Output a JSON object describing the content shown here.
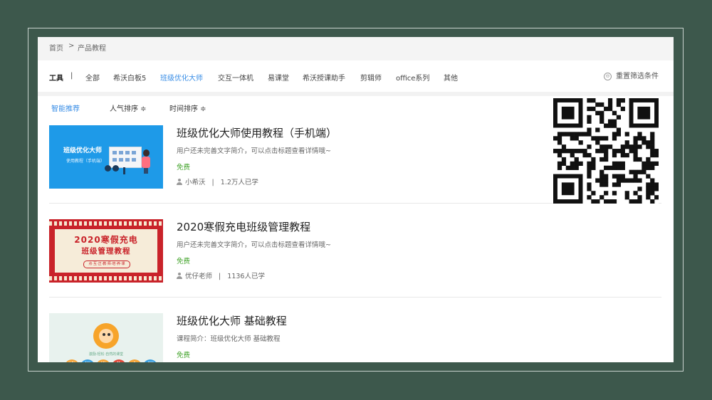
{
  "breadcrumb": {
    "home": "首页",
    "separator": ">",
    "current": "产品教程"
  },
  "toolbar": {
    "label": "工具",
    "divider": "|",
    "items": [
      {
        "label": "全部",
        "active": false
      },
      {
        "label": "希沃白板5",
        "active": false
      },
      {
        "label": "班级优化大师",
        "active": true
      },
      {
        "label": "交互一体机",
        "active": false
      },
      {
        "label": "易课堂",
        "active": false
      },
      {
        "label": "希沃授课助手",
        "active": false
      },
      {
        "label": "剪辑师",
        "active": false
      },
      {
        "label": "office系列",
        "active": false
      },
      {
        "label": "其他",
        "active": false
      }
    ],
    "reset_label": "重置筛选条件"
  },
  "sort": {
    "smart": "智能推荐",
    "popularity": "人气排序 ≑",
    "time": "时间排序 ≑"
  },
  "courses": [
    {
      "title": "班级优化大师使用教程（手机端）",
      "desc": "用户还未完善文字简介，可以点击标题查看详情哦~",
      "price": "免费",
      "author": "小希沃",
      "sep": "|",
      "learners": "1.2万人已学",
      "thumb_title": "班级优化大师",
      "thumb_sub": "使用教程（手机端）"
    },
    {
      "title": "2020寒假充电班级管理教程",
      "desc": "用户还未完善文字简介，可以点击标题查看详情哦~",
      "price": "免费",
      "author": "优仔老师",
      "sep": "|",
      "learners": "1136人已学",
      "thumb_title": "2020寒假充电",
      "thumb_sub": "班级管理教程",
      "thumb_pill": "点·互·正·教·师·培·养·课"
    },
    {
      "title": "班级优化大师 基础教程",
      "desc": "课程简介：班级优化大师 基础教程",
      "price": "免费",
      "thumb_slogan": "激励·轻松·自然的课堂",
      "thumb_chars": [
        "班",
        "级",
        "优",
        "化",
        "大",
        "师"
      ]
    }
  ],
  "colors": {
    "background": "#3d584c",
    "accent": "#3a8ee6",
    "free": "#46a52f"
  }
}
